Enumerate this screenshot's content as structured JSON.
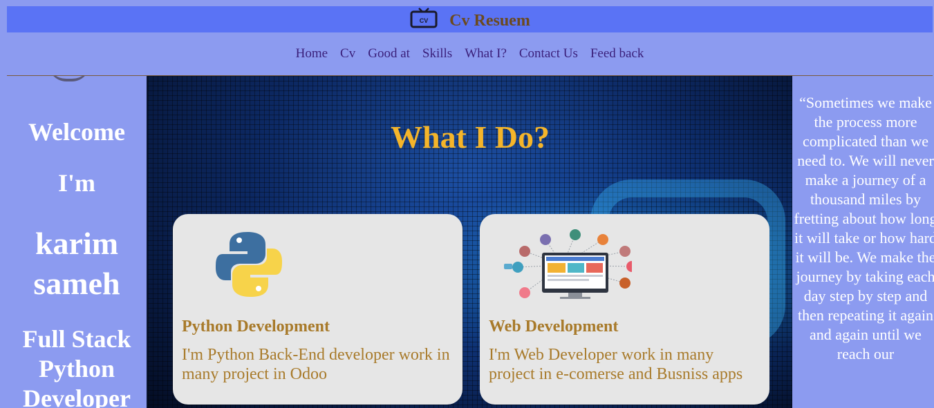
{
  "header": {
    "brand_icon": "cv-tv-icon",
    "title": "Cv Resuem"
  },
  "nav": {
    "items": [
      "Home",
      "Cv",
      "Good at",
      "Skills",
      "What I?",
      "Contact Us",
      "Feed back"
    ]
  },
  "left": {
    "welcome": "Welcome",
    "im": "I'm",
    "name": "karim sameh",
    "role": "Full Stack Python Developer"
  },
  "main": {
    "title": "What I Do?",
    "cards": [
      {
        "icon": "python-logo-icon",
        "title": "Python Development",
        "text": "I'm Python Back-End developer work in many project in Odoo"
      },
      {
        "icon": "web-development-illustration",
        "title": "Web Development",
        "text": "I'm Web Developer work in many project in e-comerse and Busniss apps"
      }
    ]
  },
  "right": {
    "quote": "“Sometimes we make the process more complicated than we need to. We will never make a journey of a thousand miles by fretting about how long it will take or how hard it will be. We make the journey by taking each day step by step and then repeating it again and again until we reach our"
  },
  "colors": {
    "page_bg": "#8c9bf0",
    "topbar_bg": "#5a73f5",
    "brand_text": "#6b4a1f",
    "nav_text": "#3a1f7a",
    "hero_title": "#f5b52a",
    "card_bg": "#e6e6e6",
    "card_text": "#a87a2a"
  }
}
